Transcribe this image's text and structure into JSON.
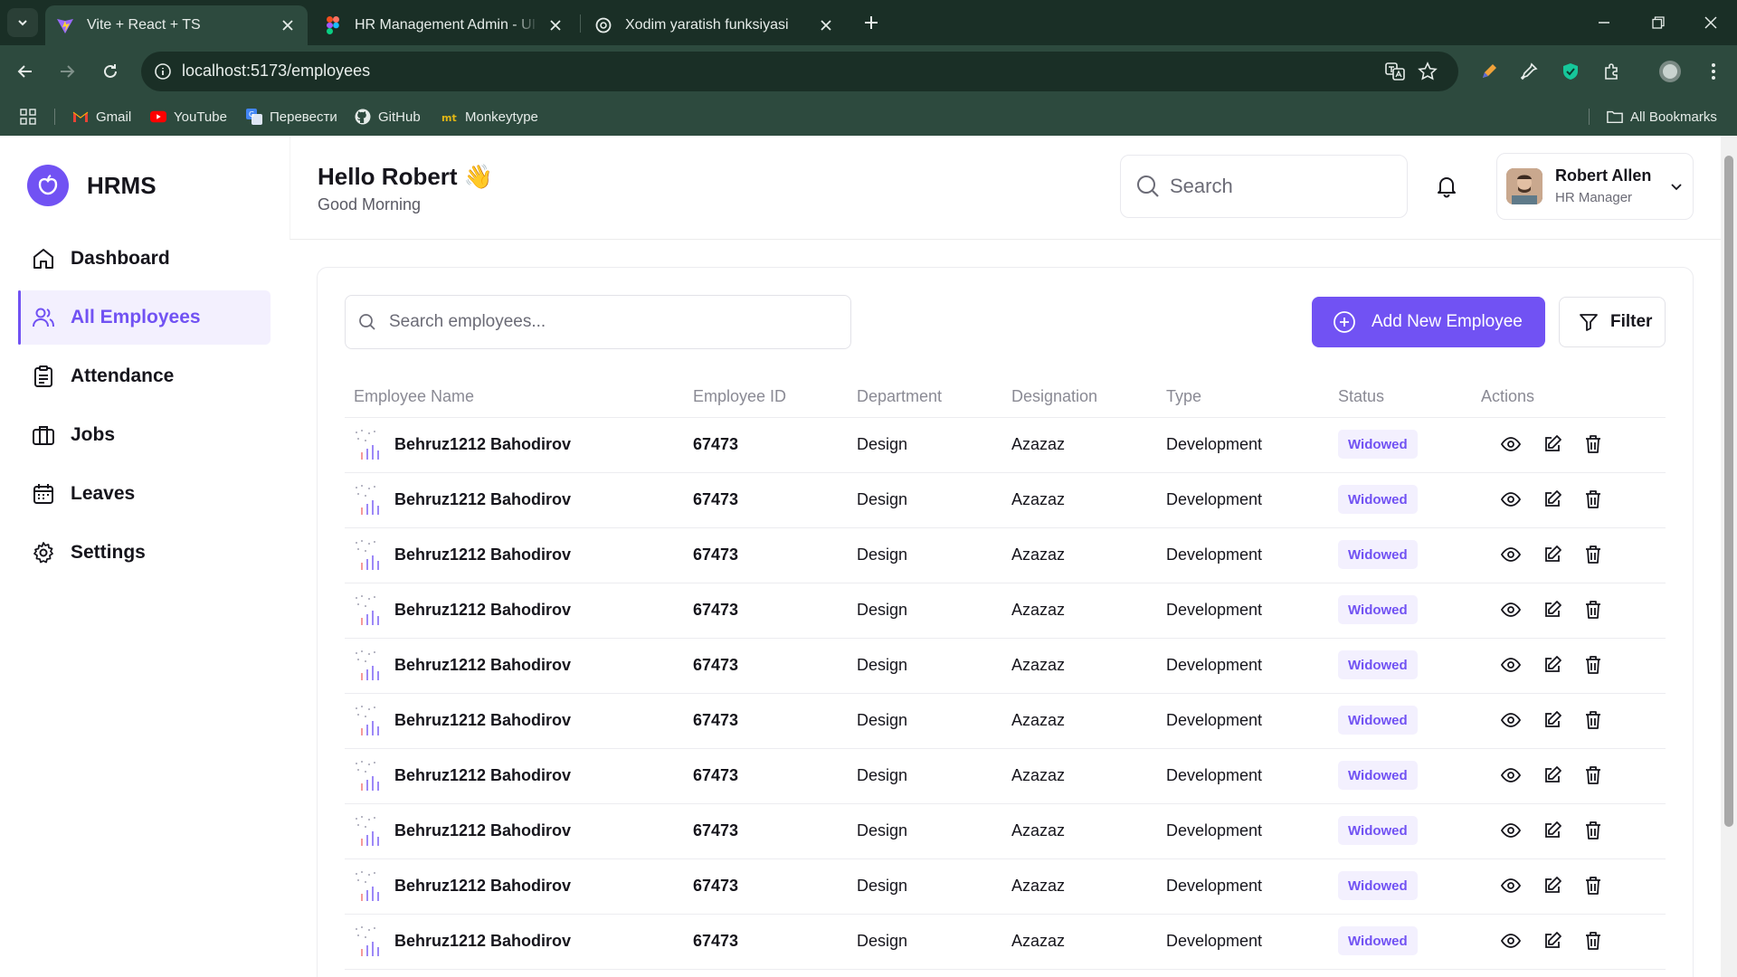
{
  "browser": {
    "tabs": [
      {
        "title": "Vite + React + TS",
        "active": true,
        "icon": "vite-icon"
      },
      {
        "title": "HR Management Admin - UI Kit",
        "active": false,
        "icon": "figma-icon"
      },
      {
        "title": "Xodim yaratish funksiyasi",
        "active": false,
        "icon": "openai-icon"
      }
    ],
    "url": "localhost:5173/employees",
    "bookmarks": [
      {
        "label": "Gmail",
        "icon": "gmail-icon"
      },
      {
        "label": "YouTube",
        "icon": "youtube-icon"
      },
      {
        "label": "Перевести",
        "icon": "translate-icon"
      },
      {
        "label": "GitHub",
        "icon": "github-icon"
      },
      {
        "label": "Monkeytype",
        "icon": "monkeytype-icon"
      }
    ],
    "all_bookmarks": "All Bookmarks"
  },
  "app": {
    "brand": "HRMS",
    "accent": "#7152f3",
    "nav": [
      {
        "label": "Dashboard",
        "icon": "home-icon",
        "active": false
      },
      {
        "label": "All Employees",
        "icon": "users-icon",
        "active": true
      },
      {
        "label": "Attendance",
        "icon": "clipboard-icon",
        "active": false
      },
      {
        "label": "Jobs",
        "icon": "briefcase-icon",
        "active": false
      },
      {
        "label": "Leaves",
        "icon": "calendar-icon",
        "active": false
      },
      {
        "label": "Settings",
        "icon": "gear-icon",
        "active": false
      }
    ],
    "header": {
      "greeting": "Hello Robert 👋",
      "subtitle": "Good Morning",
      "search_placeholder": "Search",
      "user_name": "Robert Allen",
      "user_role": "HR Manager"
    },
    "table": {
      "search_placeholder": "Search employees...",
      "add_button": "Add New Employee",
      "filter_button": "Filter",
      "columns": [
        "Employee Name",
        "Employee ID",
        "Department",
        "Designation",
        "Type",
        "Status",
        "Actions"
      ],
      "rows": [
        {
          "name": "Behruz1212 Bahodirov",
          "id": "67473",
          "department": "Design",
          "designation": "Azazaz",
          "type": "Development",
          "status": "Widowed"
        },
        {
          "name": "Behruz1212 Bahodirov",
          "id": "67473",
          "department": "Design",
          "designation": "Azazaz",
          "type": "Development",
          "status": "Widowed"
        },
        {
          "name": "Behruz1212 Bahodirov",
          "id": "67473",
          "department": "Design",
          "designation": "Azazaz",
          "type": "Development",
          "status": "Widowed"
        },
        {
          "name": "Behruz1212 Bahodirov",
          "id": "67473",
          "department": "Design",
          "designation": "Azazaz",
          "type": "Development",
          "status": "Widowed"
        },
        {
          "name": "Behruz1212 Bahodirov",
          "id": "67473",
          "department": "Design",
          "designation": "Azazaz",
          "type": "Development",
          "status": "Widowed"
        },
        {
          "name": "Behruz1212 Bahodirov",
          "id": "67473",
          "department": "Design",
          "designation": "Azazaz",
          "type": "Development",
          "status": "Widowed"
        },
        {
          "name": "Behruz1212 Bahodirov",
          "id": "67473",
          "department": "Design",
          "designation": "Azazaz",
          "type": "Development",
          "status": "Widowed"
        },
        {
          "name": "Behruz1212 Bahodirov",
          "id": "67473",
          "department": "Design",
          "designation": "Azazaz",
          "type": "Development",
          "status": "Widowed"
        },
        {
          "name": "Behruz1212 Bahodirov",
          "id": "67473",
          "department": "Design",
          "designation": "Azazaz",
          "type": "Development",
          "status": "Widowed"
        },
        {
          "name": "Behruz1212 Bahodirov",
          "id": "67473",
          "department": "Design",
          "designation": "Azazaz",
          "type": "Development",
          "status": "Widowed"
        }
      ]
    }
  }
}
